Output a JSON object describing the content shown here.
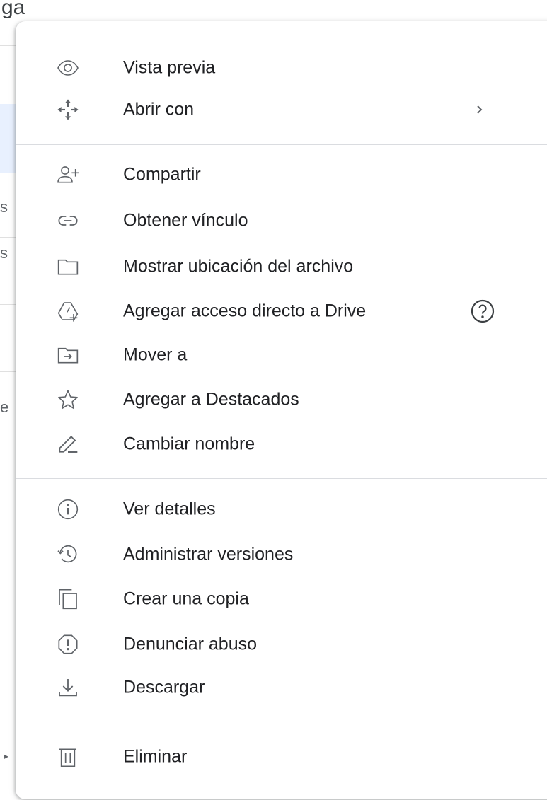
{
  "background": {
    "partial_text_top": "ga",
    "partial_chars": [
      "s",
      "s",
      "e"
    ]
  },
  "menu": {
    "items": [
      {
        "label": "Vista previa",
        "icon": "eye-icon"
      },
      {
        "label": "Abrir con",
        "icon": "move-arrows-icon",
        "submenu_indicator": "chevron-right-icon"
      },
      {
        "label": "Compartir",
        "icon": "person-add-icon"
      },
      {
        "label": "Obtener vínculo",
        "icon": "link-icon"
      },
      {
        "label": "Mostrar ubicación del archivo",
        "icon": "folder-icon"
      },
      {
        "label": "Agregar acceso directo a Drive",
        "icon": "drive-shortcut-add-icon",
        "help_icon": "help-circle-icon"
      },
      {
        "label": "Mover a",
        "icon": "folder-move-icon"
      },
      {
        "label": "Agregar a Destacados",
        "icon": "star-outline-icon"
      },
      {
        "label": "Cambiar nombre",
        "icon": "pencil-icon"
      },
      {
        "label": "Ver detalles",
        "icon": "info-icon"
      },
      {
        "label": "Administrar versiones",
        "icon": "history-icon"
      },
      {
        "label": "Crear una copia",
        "icon": "copy-icon"
      },
      {
        "label": "Denunciar abuso",
        "icon": "report-icon"
      },
      {
        "label": "Descargar",
        "icon": "download-icon"
      },
      {
        "label": "Eliminar",
        "icon": "trash-icon"
      }
    ]
  },
  "colors": {
    "text": "#202124",
    "icon": "#5f6368",
    "divider": "#dadce0",
    "selection_bg": "#e8f0fe"
  }
}
